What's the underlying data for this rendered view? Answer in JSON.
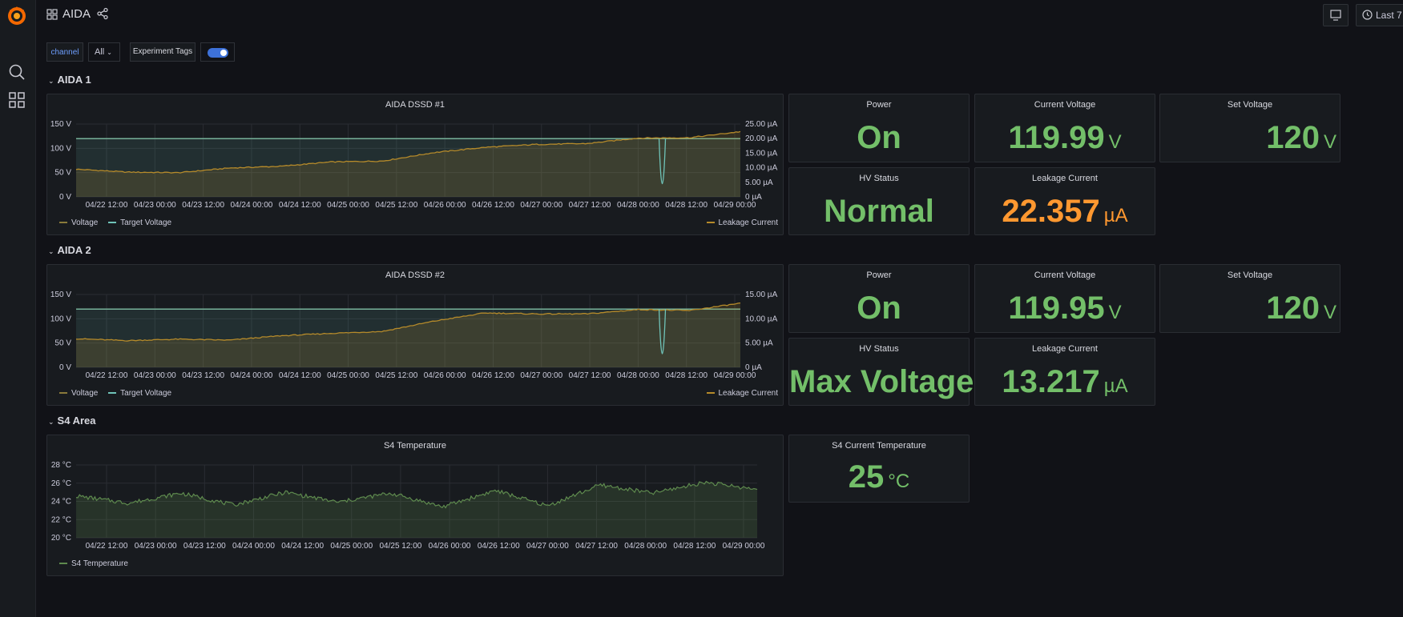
{
  "app": {
    "dashboard_title": "AIDA",
    "time_range": "Last 7"
  },
  "variables": {
    "channel_label": "channel",
    "channel_value": "All",
    "annotation_label": "Experiment Tags"
  },
  "rows": [
    {
      "title": "AIDA 1"
    },
    {
      "title": "AIDA 2"
    },
    {
      "title": "S4 Area"
    }
  ],
  "aida1": {
    "graph_title": "AIDA DSSD #1",
    "stats": {
      "power": {
        "title": "Power",
        "value": "On"
      },
      "current_voltage": {
        "title": "Current Voltage",
        "value": "119.99",
        "unit": "V"
      },
      "set_voltage": {
        "title": "Set Voltage",
        "value": "120",
        "unit": "V"
      },
      "hv_status": {
        "title": "HV Status",
        "value": "Normal"
      },
      "leakage_current": {
        "title": "Leakage Current",
        "value": "22.357",
        "unit": "µA"
      }
    }
  },
  "aida2": {
    "graph_title": "AIDA DSSD #2",
    "stats": {
      "power": {
        "title": "Power",
        "value": "On"
      },
      "current_voltage": {
        "title": "Current Voltage",
        "value": "119.95",
        "unit": "V"
      },
      "set_voltage": {
        "title": "Set Voltage",
        "value": "120",
        "unit": "V"
      },
      "hv_status": {
        "title": "HV Status",
        "value": "Max Voltage"
      },
      "leakage_current": {
        "title": "Leakage Current",
        "value": "13.217",
        "unit": "µA"
      }
    }
  },
  "s4": {
    "graph_title": "S4 Temperature",
    "stats": {
      "current_temperature": {
        "title": "S4 Current Temperature",
        "value": "25",
        "unit": "°C"
      }
    }
  },
  "colors": {
    "voltage": "#8a7a3a",
    "target_voltage": "#6fc3b8",
    "leakage": "#b58a2a",
    "temperature": "#5e8a4e",
    "green_value": "#73bf69",
    "orange_value": "#ff9830"
  },
  "chart_data": [
    {
      "type": "line",
      "title": "AIDA DSSD #1",
      "x": [
        "04/22 12:00",
        "04/23 00:00",
        "04/23 12:00",
        "04/24 00:00",
        "04/24 12:00",
        "04/25 00:00",
        "04/25 12:00",
        "04/26 00:00",
        "04/26 12:00",
        "04/27 00:00",
        "04/27 12:00",
        "04/28 00:00",
        "04/28 12:00",
        "04/29 00:00"
      ],
      "y_left_ticks": [
        "150 V",
        "100 V",
        "50 V",
        "0 V"
      ],
      "y_right_ticks": [
        "25.00 µA",
        "20.00 µA",
        "15.00 µA",
        "10.00 µA",
        "5.00 µA",
        "0 µA"
      ],
      "ylim_left": [
        0,
        150
      ],
      "ylim_right": [
        0,
        25
      ],
      "series": [
        {
          "name": "Voltage",
          "axis": "left",
          "values": [
            120,
            120,
            120,
            120,
            120,
            120,
            120,
            120,
            120,
            120,
            120,
            120,
            120,
            120
          ]
        },
        {
          "name": "Target Voltage",
          "axis": "left",
          "values": [
            120,
            120,
            120,
            120,
            120,
            120,
            120,
            120,
            120,
            120,
            120,
            120,
            120,
            120
          ]
        },
        {
          "name": "Leakage Current",
          "axis": "right",
          "values": [
            9.5,
            8.5,
            8.3,
            9.9,
            10.5,
            12.0,
            12.3,
            15.2,
            17.0,
            18.0,
            18.3,
            20.2,
            20.3,
            22.4
          ]
        }
      ],
      "dip": {
        "x": "04/28 06:00",
        "leakage_min": 4.5
      },
      "legend": {
        "left": [
          "Voltage",
          "Target Voltage"
        ],
        "right": [
          "Leakage Current"
        ]
      }
    },
    {
      "type": "line",
      "title": "AIDA DSSD #2",
      "x": [
        "04/22 12:00",
        "04/23 00:00",
        "04/23 12:00",
        "04/24 00:00",
        "04/24 12:00",
        "04/25 00:00",
        "04/25 12:00",
        "04/26 00:00",
        "04/26 12:00",
        "04/27 00:00",
        "04/27 12:00",
        "04/28 00:00",
        "04/28 12:00",
        "04/29 00:00"
      ],
      "y_left_ticks": [
        "150 V",
        "100 V",
        "50 V",
        "0 V"
      ],
      "y_right_ticks": [
        "15.00 µA",
        "10.00 µA",
        "5.00 µA",
        "0 µA"
      ],
      "ylim_left": [
        0,
        150
      ],
      "ylim_right": [
        0,
        15
      ],
      "series": [
        {
          "name": "Voltage",
          "axis": "left",
          "values": [
            120,
            120,
            120,
            120,
            120,
            120,
            120,
            120,
            120,
            120,
            120,
            120,
            120,
            120
          ]
        },
        {
          "name": "Target Voltage",
          "axis": "left",
          "values": [
            120,
            120,
            120,
            120,
            120,
            120,
            120,
            120,
            120,
            120,
            120,
            120,
            120,
            120
          ]
        },
        {
          "name": "Leakage Current",
          "axis": "right",
          "values": [
            5.9,
            5.5,
            5.8,
            5.6,
            6.5,
            7.0,
            7.4,
            9.5,
            11.2,
            11.0,
            11.0,
            11.9,
            11.7,
            13.2
          ]
        }
      ],
      "dip": {
        "x": "04/28 06:00",
        "leakage_min": 2.8
      },
      "legend": {
        "left": [
          "Voltage",
          "Target Voltage"
        ],
        "right": [
          "Leakage Current"
        ]
      }
    },
    {
      "type": "line",
      "title": "S4 Temperature",
      "x": [
        "04/22 12:00",
        "04/23 00:00",
        "04/23 12:00",
        "04/24 00:00",
        "04/24 12:00",
        "04/25 00:00",
        "04/25 12:00",
        "04/26 00:00",
        "04/26 12:00",
        "04/27 00:00",
        "04/27 12:00",
        "04/28 00:00",
        "04/28 12:00",
        "04/29 00:00"
      ],
      "y_ticks": [
        "28 °C",
        "26 °C",
        "24 °C",
        "22 °C",
        "20 °C"
      ],
      "ylim": [
        20,
        28
      ],
      "series": [
        {
          "name": "S4 Temperature",
          "values": [
            24.6,
            23.8,
            24.9,
            23.6,
            25.0,
            23.9,
            24.9,
            23.4,
            25.2,
            23.5,
            25.8,
            24.9,
            26.1,
            25.3
          ]
        }
      ],
      "legend": [
        "S4 Temperature"
      ]
    }
  ]
}
